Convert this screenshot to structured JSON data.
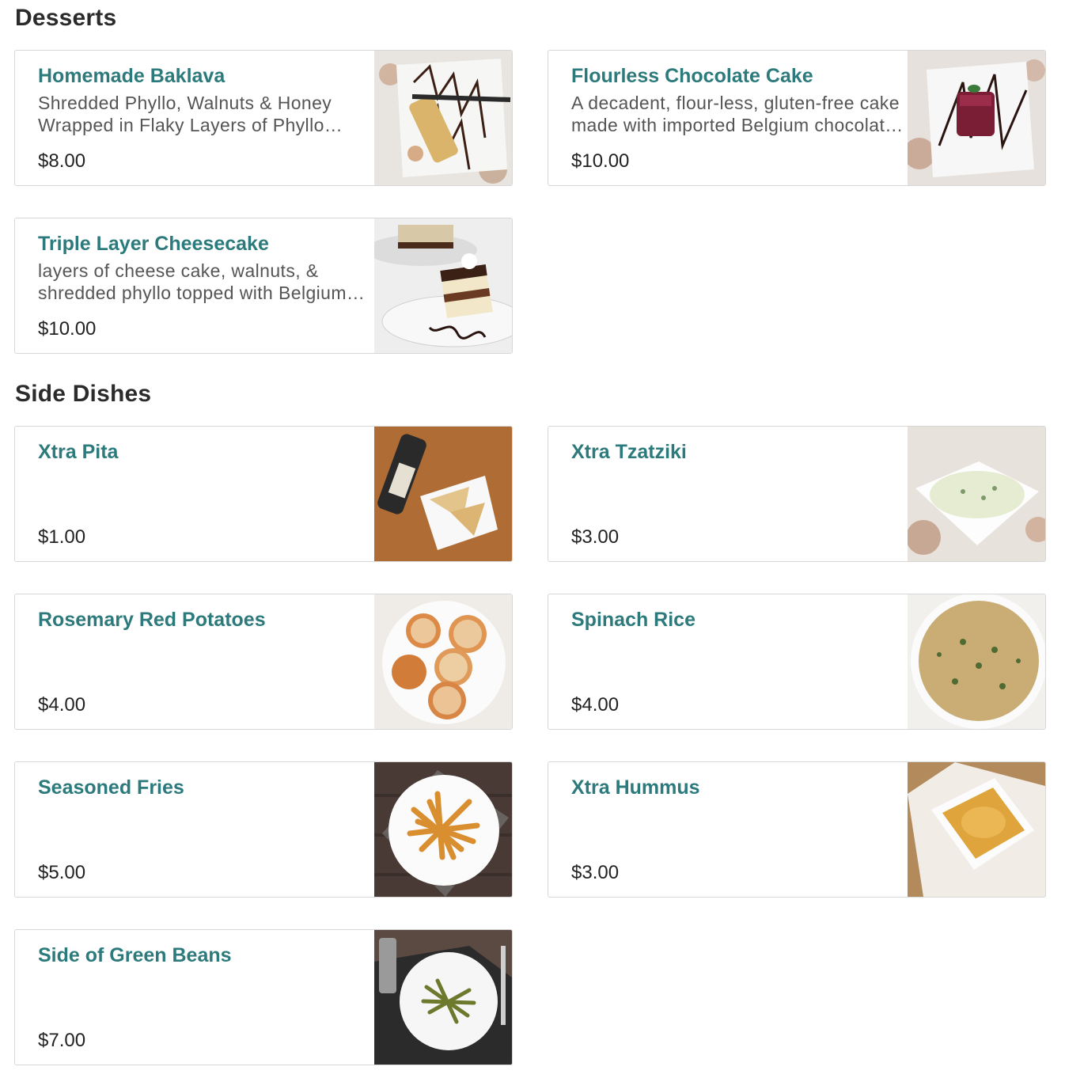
{
  "sections": [
    {
      "title": "Desserts",
      "items": [
        {
          "name": "Homemade Baklava",
          "description": "Shredded Phyllo, Walnuts & Honey Wrapped in Flaky Layers of Phyllo Dough",
          "price": "$8.00",
          "image": "baklava-photo"
        },
        {
          "name": "Flourless Chocolate Cake",
          "description": "A decadent, flour-less, gluten-free cake made with imported Belgium chocolate infused with raspberry",
          "price": "$10.00",
          "image": "chocolate-cake-photo"
        },
        {
          "name": "Triple Layer Cheesecake",
          "description": "layers of cheese cake, walnuts, & shredded phyllo topped with Belgium chocolate ganache. Topped",
          "price": "$10.00",
          "image": "cheesecake-photo"
        }
      ]
    },
    {
      "title": "Side Dishes",
      "items": [
        {
          "name": "Xtra Pita",
          "description": "",
          "price": "$1.00",
          "image": "pita-photo"
        },
        {
          "name": "Xtra Tzatziki",
          "description": "",
          "price": "$3.00",
          "image": "tzatziki-photo"
        },
        {
          "name": "Rosemary Red Potatoes",
          "description": "",
          "price": "$4.00",
          "image": "potatoes-photo"
        },
        {
          "name": "Spinach Rice",
          "description": "",
          "price": "$4.00",
          "image": "rice-photo"
        },
        {
          "name": "Seasoned Fries",
          "description": "",
          "price": "$5.00",
          "image": "fries-photo"
        },
        {
          "name": "Xtra Hummus",
          "description": "",
          "price": "$3.00",
          "image": "hummus-photo"
        },
        {
          "name": "Side of Green Beans",
          "description": "",
          "price": "$7.00",
          "image": "green-beans-photo"
        }
      ]
    }
  ],
  "colors": {
    "item_name": "#2c7a7b",
    "card_border": "#d7d7d7",
    "section_title": "#2b2b2b"
  }
}
